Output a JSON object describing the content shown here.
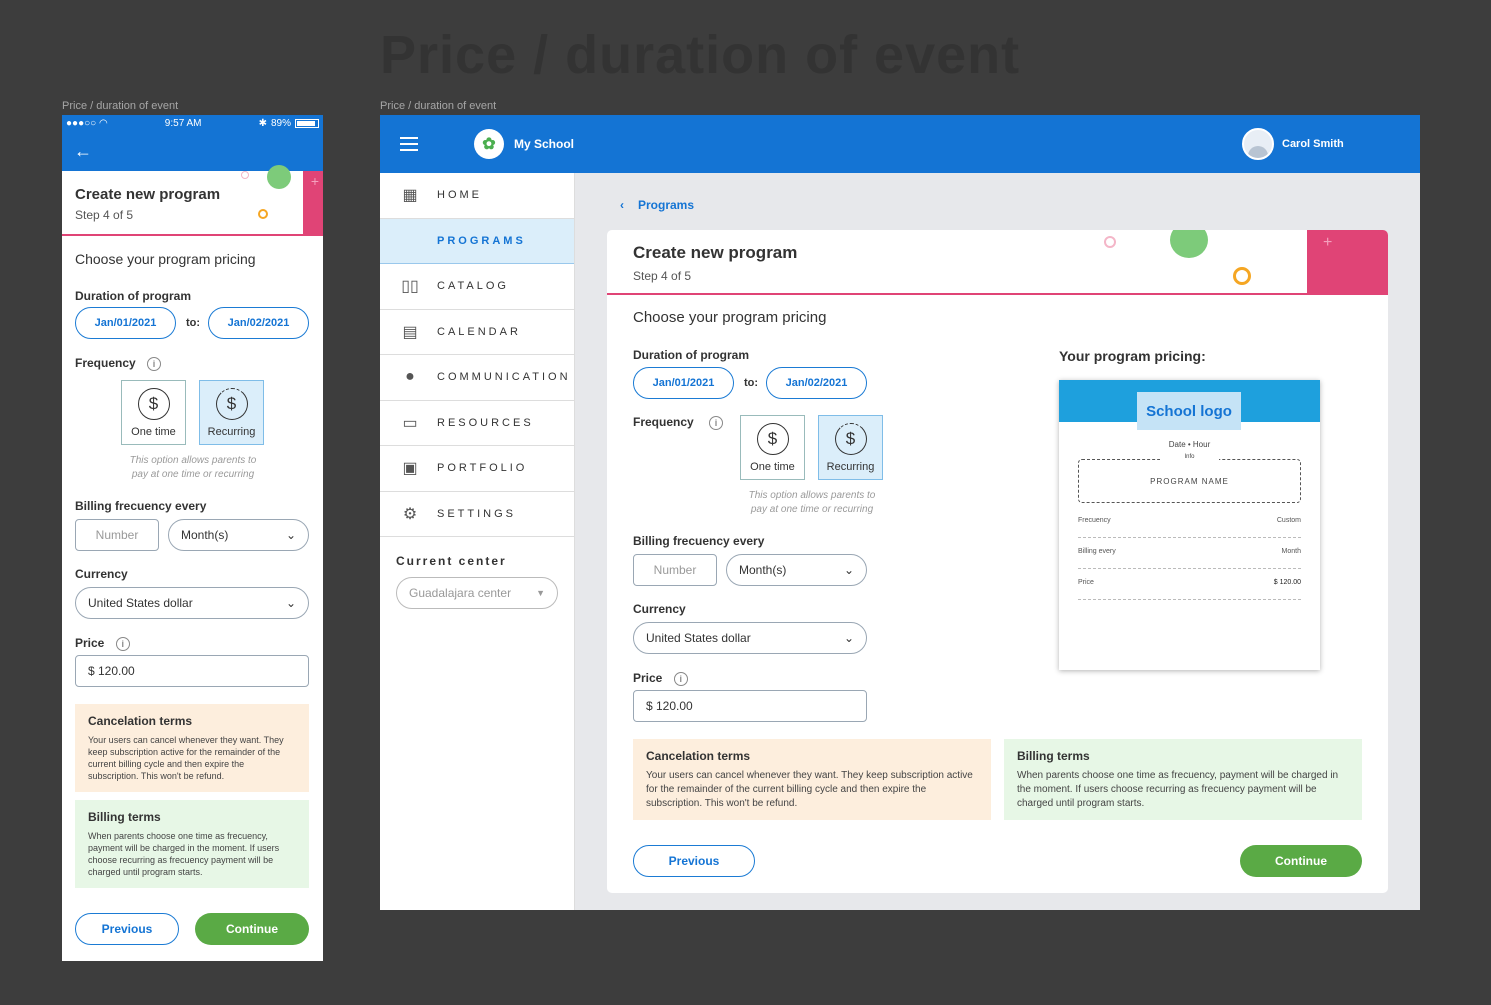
{
  "page_title": "Price / duration of event",
  "mobile": {
    "frame_label": "Price / duration of event",
    "status": {
      "signal": "●●●○○",
      "time": "9:57 AM",
      "battery": "89%"
    },
    "header": {
      "title": "Create new program",
      "step": "Step 4 of 5"
    },
    "section_title": "Choose your program pricing",
    "duration": {
      "label": "Duration of program",
      "from": "Jan/01/2021",
      "to_label": "to:",
      "to": "Jan/02/2021"
    },
    "frequency": {
      "label": "Frequency",
      "info": "i",
      "options": [
        "One time",
        "Recurring"
      ],
      "selected": "Recurring",
      "hint_line1": "This option allows parents to",
      "hint_line2": "pay at one time or recurring"
    },
    "billing": {
      "label": "Billing frecuency every",
      "number_placeholder": "Number",
      "unit": "Month(s)"
    },
    "currency": {
      "label": "Currency",
      "value": "United States dollar"
    },
    "price": {
      "label": "Price",
      "info": "i",
      "value": "$ 120.00"
    },
    "cancel_terms": {
      "title": "Cancelation terms",
      "text": "Your users can cancel whenever they want. They keep subscription active for the remainder of the current billing cycle and then expire the subscription. This won't be refund."
    },
    "billing_terms": {
      "title": "Billing terms",
      "text": "When parents choose one time as frecuency, payment will be charged in the moment. If users choose recurring as frecuency payment will be charged until program starts."
    },
    "buttons": {
      "previous": "Previous",
      "continue": "Continue"
    }
  },
  "desktop": {
    "frame_label": "Price / duration of event",
    "app_name": "My School",
    "user_name": "Carol Smith",
    "nav": [
      {
        "label": "HOME",
        "icon": "home-icon",
        "active": false
      },
      {
        "label": "PROGRAMS",
        "icon": "programs-icon",
        "active": true
      },
      {
        "label": "CATALOG",
        "icon": "book-icon",
        "active": false
      },
      {
        "label": "CALENDAR",
        "icon": "calendar-icon",
        "active": false
      },
      {
        "label": "COMMUNICATION",
        "icon": "chat-icon",
        "active": false
      },
      {
        "label": "RESOURCES",
        "icon": "resources-icon",
        "active": false
      },
      {
        "label": "PORTFOLIO",
        "icon": "portfolio-icon",
        "active": false
      },
      {
        "label": "SETTINGS",
        "icon": "gear-icon",
        "active": false
      }
    ],
    "current_center": {
      "label": "Current center",
      "value": "Guadalajara center"
    },
    "breadcrumb": "Programs",
    "header": {
      "title": "Create new program",
      "step": "Step 4 of 5"
    },
    "section_title": "Choose your program pricing",
    "duration": {
      "label": "Duration of program",
      "from": "Jan/01/2021",
      "to_label": "to:",
      "to": "Jan/02/2021"
    },
    "frequency": {
      "label": "Frequency",
      "info": "i",
      "options": [
        "One time",
        "Recurring"
      ],
      "selected": "Recurring",
      "hint_line1": "This option allows parents to",
      "hint_line2": "pay at one time or recurring"
    },
    "billing": {
      "label": "Billing frecuency every",
      "number_placeholder": "Number",
      "unit": "Month(s)"
    },
    "currency": {
      "label": "Currency",
      "value": "United States dollar"
    },
    "price": {
      "label": "Price",
      "info": "i",
      "value": "$ 120.00"
    },
    "preview": {
      "title": "Your program pricing:",
      "logo": "School logo",
      "date_hour": "Date • Hour",
      "info": "Info",
      "program_name": "PROGRAM NAME",
      "rows": [
        {
          "label": "Frecuency",
          "value": "Custom"
        },
        {
          "label": "Billing every",
          "value": "Month"
        },
        {
          "label": "Price",
          "value": "$ 120.00"
        }
      ]
    },
    "cancel_terms": {
      "title": "Cancelation terms",
      "text": "Your users can cancel whenever they want. They keep subscription active for the remainder of the current billing cycle and then expire the subscription. This won't be refund."
    },
    "billing_terms": {
      "title": "Billing terms",
      "text": "When parents choose one time as frecuency, payment will be charged in the moment. If users choose recurring as frecuency payment will be charged until program starts."
    },
    "buttons": {
      "previous": "Previous",
      "continue": "Continue"
    }
  },
  "colors": {
    "brand_blue": "#1474d4",
    "accent_pink": "#e04476",
    "success_green": "#5aaa45",
    "selected_bg": "#dbeefa"
  }
}
